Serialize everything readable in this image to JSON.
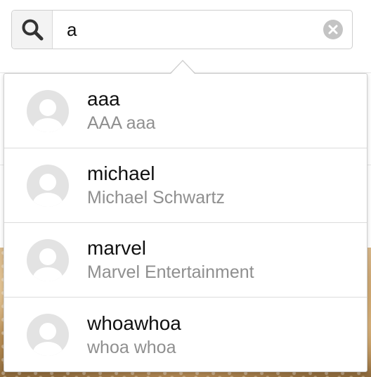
{
  "search": {
    "value": "a",
    "icon": "search-icon",
    "clear_icon": "clear-icon"
  },
  "results": [
    {
      "username": "aaa",
      "fullname": "AAA aaa"
    },
    {
      "username": "michael",
      "fullname": "Michael Schwartz"
    },
    {
      "username": "marvel",
      "fullname": "Marvel Entertainment"
    },
    {
      "username": "whoawhoa",
      "fullname": "whoa whoa"
    }
  ],
  "colors": {
    "border": "#cfcfcf",
    "secondary_text": "#8f8f8f",
    "avatar_bg": "#e3e3e3"
  }
}
